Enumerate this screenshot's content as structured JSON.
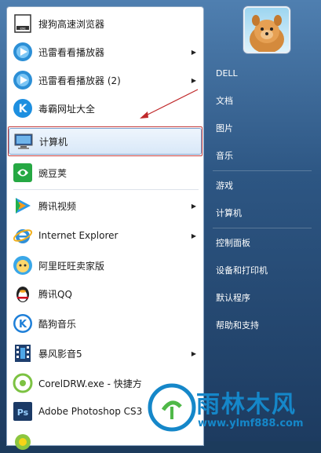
{
  "left_items": [
    {
      "label": "搜狗高速浏览器",
      "icon": "sogou-browser-icon",
      "arrow": false
    },
    {
      "label": "迅雷看看播放器",
      "icon": "xunlei-player-icon",
      "arrow": true
    },
    {
      "label": "迅雷看看播放器 (2)",
      "icon": "xunlei-player-icon",
      "arrow": true
    },
    {
      "label": "毒霸网址大全",
      "icon": "duba-k-icon",
      "arrow": false
    },
    {
      "label": "计算机",
      "icon": "computer-icon",
      "arrow": false
    },
    {
      "label": "豌豆荚",
      "icon": "wandoujia-icon",
      "arrow": false
    },
    {
      "label": "腾讯视频",
      "icon": "tencent-video-icon",
      "arrow": true
    },
    {
      "label": "Internet Explorer",
      "icon": "internet-explorer-icon",
      "arrow": true
    },
    {
      "label": "阿里旺旺卖家版",
      "icon": "aliwangwang-icon",
      "arrow": false
    },
    {
      "label": "腾讯QQ",
      "icon": "qq-penguin-icon",
      "arrow": false
    },
    {
      "label": "酷狗音乐",
      "icon": "kugou-k-icon",
      "arrow": false
    },
    {
      "label": "暴风影音5",
      "icon": "baofeng-film-icon",
      "arrow": true
    },
    {
      "label": "CorelDRW.exe - 快捷方",
      "icon": "coreldraw-icon",
      "arrow": false
    },
    {
      "label": "Adobe Photoshop CS3",
      "icon": "photoshop-icon",
      "arrow": false
    },
    {
      "label": "",
      "icon": "partial-app-icon",
      "arrow": false
    }
  ],
  "ps_text": "Ps",
  "right_items": [
    {
      "label": "DELL"
    },
    {
      "label": "文档"
    },
    {
      "label": "图片"
    },
    {
      "label": "音乐"
    },
    {
      "label": "游戏"
    },
    {
      "label": "计算机"
    },
    {
      "label": "控制面板"
    },
    {
      "label": "设备和打印机"
    },
    {
      "label": "默认程序"
    },
    {
      "label": "帮助和支持"
    }
  ],
  "watermark": {
    "text": "雨林木风",
    "url": "www.ylmf888.com"
  },
  "colors": {
    "accent_red": "#c23a3a",
    "watermark_blue": "#1587c9"
  }
}
